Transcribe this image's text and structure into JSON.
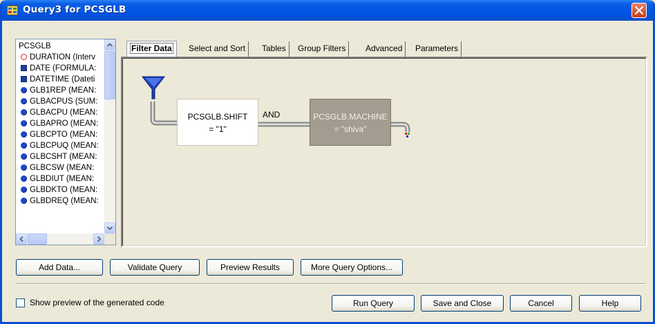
{
  "window": {
    "title": "Query3 for PCSGLB"
  },
  "field_list": {
    "items": [
      {
        "label": "PCSGLB",
        "icon": "none"
      },
      {
        "label": "DURATION (Interv",
        "icon": "clock-icon"
      },
      {
        "label": "DATE (FORMULA:",
        "icon": "calendar-icon"
      },
      {
        "label": "DATETIME (Dateti",
        "icon": "calendar-icon"
      },
      {
        "label": "GLB1REP (MEAN:",
        "icon": "numeric-dot-icon"
      },
      {
        "label": "GLBACPUS (SUM:",
        "icon": "numeric-dot-icon"
      },
      {
        "label": "GLBACPU (MEAN:",
        "icon": "numeric-dot-icon"
      },
      {
        "label": "GLBAPRO (MEAN:",
        "icon": "numeric-dot-icon"
      },
      {
        "label": "GLBCPTO (MEAN:",
        "icon": "numeric-dot-icon"
      },
      {
        "label": "GLBCPUQ (MEAN:",
        "icon": "numeric-dot-icon"
      },
      {
        "label": "GLBCSHT (MEAN:",
        "icon": "numeric-dot-icon"
      },
      {
        "label": "GLBCSW (MEAN:",
        "icon": "numeric-dot-icon"
      },
      {
        "label": "GLBDIUT (MEAN:",
        "icon": "numeric-dot-icon"
      },
      {
        "label": "GLBDKTO (MEAN:",
        "icon": "numeric-dot-icon"
      },
      {
        "label": "GLBDREQ (MEAN:",
        "icon": "numeric-dot-icon"
      }
    ]
  },
  "tabs": [
    {
      "label": "Filter Data",
      "active": true
    },
    {
      "label": "Select and Sort",
      "active": false
    },
    {
      "label": "Tables",
      "active": false
    },
    {
      "label": "Group Filters",
      "active": false
    },
    {
      "label": "Advanced",
      "active": false
    },
    {
      "label": "Parameters",
      "active": false
    }
  ],
  "filters": {
    "first": {
      "line1": "PCSGLB.SHIFT",
      "line2": "= \"1\""
    },
    "connector": "AND",
    "second": {
      "line1": "PCSGLB.MACHINE",
      "line2": "= \"shiva\""
    }
  },
  "actions": {
    "add_data": "Add Data...",
    "validate_query": "Validate Query",
    "preview_results": "Preview Results",
    "more_options": "More Query Options..."
  },
  "footer": {
    "show_preview_label": "Show preview of the generated code",
    "run_query": "Run Query",
    "save_close": "Save and Close",
    "cancel": "Cancel",
    "help": "Help"
  },
  "colors": {
    "title_bar": "#0055e5",
    "close_button": "#cc3b12",
    "funnel": "#1d3fbf",
    "disabled_filter": "#a39c90"
  }
}
